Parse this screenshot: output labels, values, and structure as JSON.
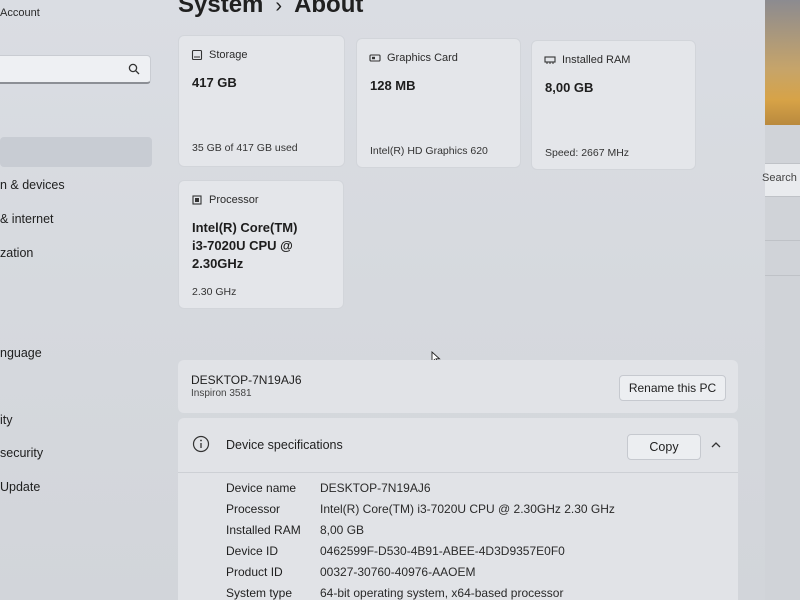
{
  "sidebar": {
    "account_label": "Account",
    "search_placeholder": "",
    "items": [
      {
        "label": "n & devices"
      },
      {
        "label": "& internet"
      },
      {
        "label": "zation"
      },
      {
        "label": "nguage"
      },
      {
        "label": "ity"
      },
      {
        "label": "security"
      },
      {
        "label": "Update"
      }
    ]
  },
  "header": {
    "parent": "System",
    "separator": "›",
    "current": "About"
  },
  "cards": {
    "storage": {
      "title": "Storage",
      "value": "417 GB",
      "sub": "35 GB of 417 GB used",
      "icon": "storage-icon"
    },
    "graphics": {
      "title": "Graphics Card",
      "value": "128 MB",
      "sub": "Intel(R) HD Graphics 620",
      "icon": "graphics-card-icon"
    },
    "ram": {
      "title": "Installed RAM",
      "value": "8,00 GB",
      "sub": "Speed: 2667 MHz",
      "icon": "ram-icon"
    },
    "processor": {
      "title": "Processor",
      "value_lines": [
        "Intel(R) Core(TM)",
        "i3-7020U CPU @",
        "2.30GHz"
      ],
      "sub": "2.30 GHz",
      "icon": "processor-icon"
    }
  },
  "pc": {
    "name": "DESKTOP-7N19AJ6",
    "model": "Inspiron 3581",
    "rename_label": "Rename this PC"
  },
  "specs": {
    "title": "Device specifications",
    "copy_label": "Copy",
    "rows": [
      {
        "key": "Device name",
        "value": "DESKTOP-7N19AJ6"
      },
      {
        "key": "Processor",
        "value": "Intel(R) Core(TM) i3-7020U CPU @ 2.30GHz   2.30 GHz"
      },
      {
        "key": "Installed RAM",
        "value": "8,00 GB"
      },
      {
        "key": "Device ID",
        "value": "0462599F-D530-4B91-ABEE-4D3D9357E0F0"
      },
      {
        "key": "Product ID",
        "value": "00327-30760-40976-AAOEM"
      },
      {
        "key": "System type",
        "value": "64-bit operating system, x64-based processor"
      }
    ]
  },
  "right_window": {
    "search_label": "Search"
  },
  "colors": {
    "window_bg": "#d8dbe0",
    "card_bg": "#e4e6ea",
    "selected_nav": "#c8ccd3"
  }
}
